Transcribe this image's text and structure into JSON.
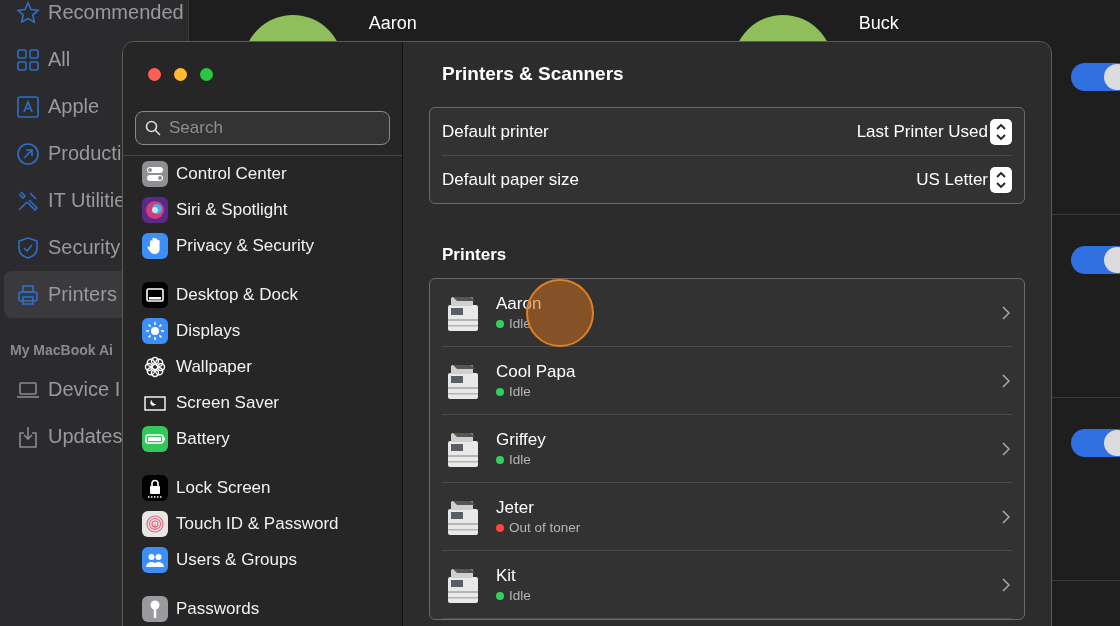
{
  "background_app": {
    "sidebar": {
      "items": [
        {
          "label": "Recommended",
          "selected": false
        },
        {
          "label": "All",
          "selected": false
        },
        {
          "label": "Apple",
          "selected": false
        },
        {
          "label": "Producti",
          "selected": false
        },
        {
          "label": "IT Utilitie",
          "selected": false
        },
        {
          "label": "Security",
          "selected": false
        },
        {
          "label": "Printers",
          "selected": true
        }
      ],
      "section": {
        "title": "My MacBook Ai",
        "items": [
          {
            "label": "Device I",
            "selected": false
          },
          {
            "label": "Updates",
            "selected": false
          }
        ]
      }
    },
    "cards": [
      {
        "name": "Aaron"
      },
      {
        "name": "Buck"
      }
    ],
    "toggles": [
      {
        "on": true
      },
      {
        "on": true
      },
      {
        "on": true
      }
    ]
  },
  "window": {
    "search": {
      "placeholder": "Search"
    },
    "sidebar_groups": [
      [
        {
          "label": "Control Center",
          "selected": false
        },
        {
          "label": "Siri & Spotlight",
          "selected": false
        },
        {
          "label": "Privacy & Security",
          "selected": false
        }
      ],
      [
        {
          "label": "Desktop & Dock",
          "selected": false
        },
        {
          "label": "Displays",
          "selected": false
        },
        {
          "label": "Wallpaper",
          "selected": false
        },
        {
          "label": "Screen Saver",
          "selected": false
        },
        {
          "label": "Battery",
          "selected": false
        }
      ],
      [
        {
          "label": "Lock Screen",
          "selected": false
        },
        {
          "label": "Touch ID & Password",
          "selected": false
        },
        {
          "label": "Users & Groups",
          "selected": false
        }
      ],
      [
        {
          "label": "Passwords",
          "selected": false
        }
      ]
    ],
    "title": "Printers & Scanners",
    "settings": [
      {
        "label": "Default printer",
        "value": "Last Printer Used"
      },
      {
        "label": "Default paper size",
        "value": "US Letter"
      }
    ],
    "printers_heading": "Printers",
    "printers": [
      {
        "name": "Aaron",
        "status": "Idle",
        "color": "#30d158",
        "click_marker": true
      },
      {
        "name": "Cool Papa",
        "status": "Idle",
        "color": "#30d158",
        "click_marker": false
      },
      {
        "name": "Griffey",
        "status": "Idle",
        "color": "#30d158",
        "click_marker": false
      },
      {
        "name": "Jeter",
        "status": "Out of toner",
        "color": "#ff453a",
        "click_marker": false
      },
      {
        "name": "Kit",
        "status": "Idle",
        "color": "#30d158",
        "click_marker": false
      }
    ]
  }
}
